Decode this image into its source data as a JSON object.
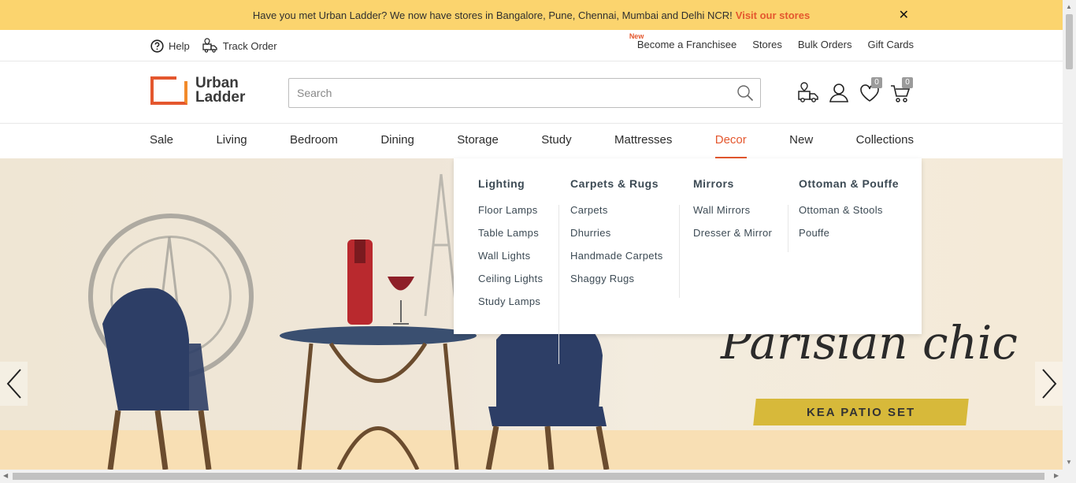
{
  "announcement": {
    "text": "Have you met Urban Ladder? We now have stores in Bangalore, Pune, Chennai, Mumbai and Delhi NCR!",
    "link": "Visit our stores",
    "close": "✕"
  },
  "utility": {
    "help": "Help",
    "track": "Track Order",
    "new_badge": "New",
    "franchise": "Become a Franchisee",
    "stores": "Stores",
    "bulk": "Bulk Orders",
    "gift": "Gift Cards"
  },
  "header": {
    "logo_line1": "Urban",
    "logo_line2": "Ladder",
    "search_placeholder": "Search",
    "wishlist_count": "0",
    "cart_count": "0"
  },
  "nav": [
    "Sale",
    "Living",
    "Bedroom",
    "Dining",
    "Storage",
    "Study",
    "Mattresses",
    "Decor",
    "New",
    "Collections"
  ],
  "active_nav": "Decor",
  "dropdown": {
    "columns": [
      {
        "title": "Lighting",
        "links": [
          "Floor Lamps",
          "Table Lamps",
          "Wall Lights",
          "Ceiling Lights",
          "Study Lamps"
        ]
      },
      {
        "title": "Carpets & Rugs",
        "links": [
          "Carpets",
          "Dhurries",
          "Handmade Carpets",
          "Shaggy Rugs"
        ]
      },
      {
        "title": "Mirrors",
        "links": [
          "Wall Mirrors",
          "Dresser & Mirror"
        ]
      },
      {
        "title": "Ottoman & Pouffe",
        "links": [
          "Ottoman & Stools",
          "Pouffe"
        ]
      }
    ]
  },
  "hero": {
    "title": "Parisian chic",
    "ribbon": "KEA PATIO SET"
  },
  "colors": {
    "accent": "#e4572e",
    "banner": "#fbd46e",
    "text": "#3c4a54"
  }
}
